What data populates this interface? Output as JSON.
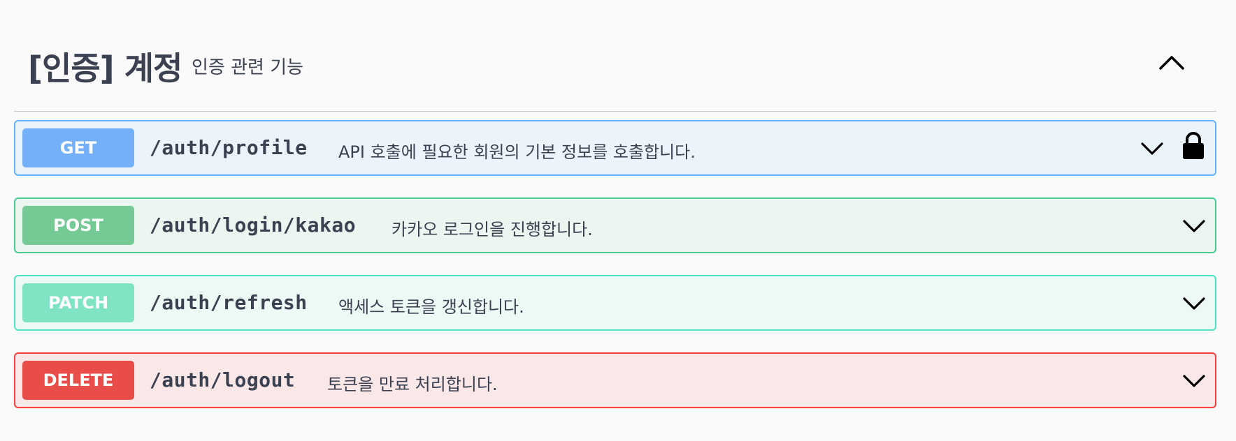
{
  "tag": {
    "title": "[인증] 계정",
    "description": "인증 관련 기능",
    "collapse_icon": "chevron-up-icon"
  },
  "operations": [
    {
      "method": "GET",
      "path": "/auth/profile",
      "summary": "API 호출에 필요한 회원의 기본 정보를 호출합니다.",
      "color": "#61affe",
      "locked": true
    },
    {
      "method": "POST",
      "path": "/auth/login/kakao",
      "summary": "카카오 로그인을 진행합니다.",
      "color": "#49cc90",
      "locked": false
    },
    {
      "method": "PATCH",
      "path": "/auth/refresh",
      "summary": "액세스 토큰을 갱신합니다.",
      "color": "#50e3c2",
      "locked": false
    },
    {
      "method": "DELETE",
      "path": "/auth/logout",
      "summary": "토큰을 만료 처리합니다.",
      "color": "#f93e3e",
      "locked": false
    }
  ]
}
